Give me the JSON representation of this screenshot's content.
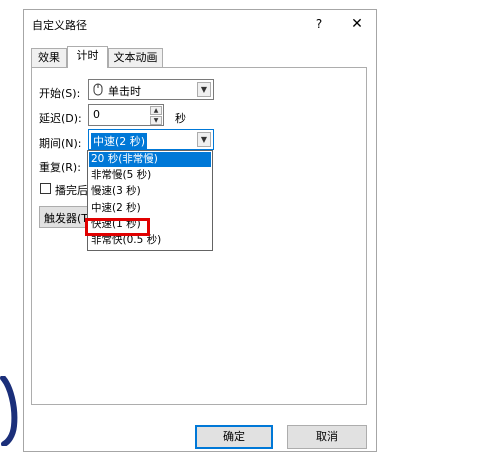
{
  "window": {
    "title": "自定义路径",
    "help": "?",
    "close": "✕"
  },
  "tabs": [
    {
      "label": "效果",
      "active": false
    },
    {
      "label": "计时",
      "active": true
    },
    {
      "label": "文本动画",
      "active": false
    }
  ],
  "timing": {
    "start_label": "开始(S):",
    "start_value": "单击时",
    "delay_label": "延迟(D):",
    "delay_value": "0",
    "delay_unit": "秒",
    "duration_label": "期间(N):",
    "duration_value": "中速(2 秒)",
    "repeat_label": "重复(R):",
    "rewind_label": "播完后快",
    "trigger_label": "触发器(T)"
  },
  "duration_options": [
    "20 秒(非常慢)",
    "非常慢(5 秒)",
    "慢速(3 秒)",
    "中速(2 秒)",
    "快速(1 秒)",
    "非常快(0.5 秒)"
  ],
  "footer": {
    "ok": "确定",
    "cancel": "取消"
  },
  "colors": {
    "accent": "#0078d7",
    "highlight": "#e00000"
  }
}
